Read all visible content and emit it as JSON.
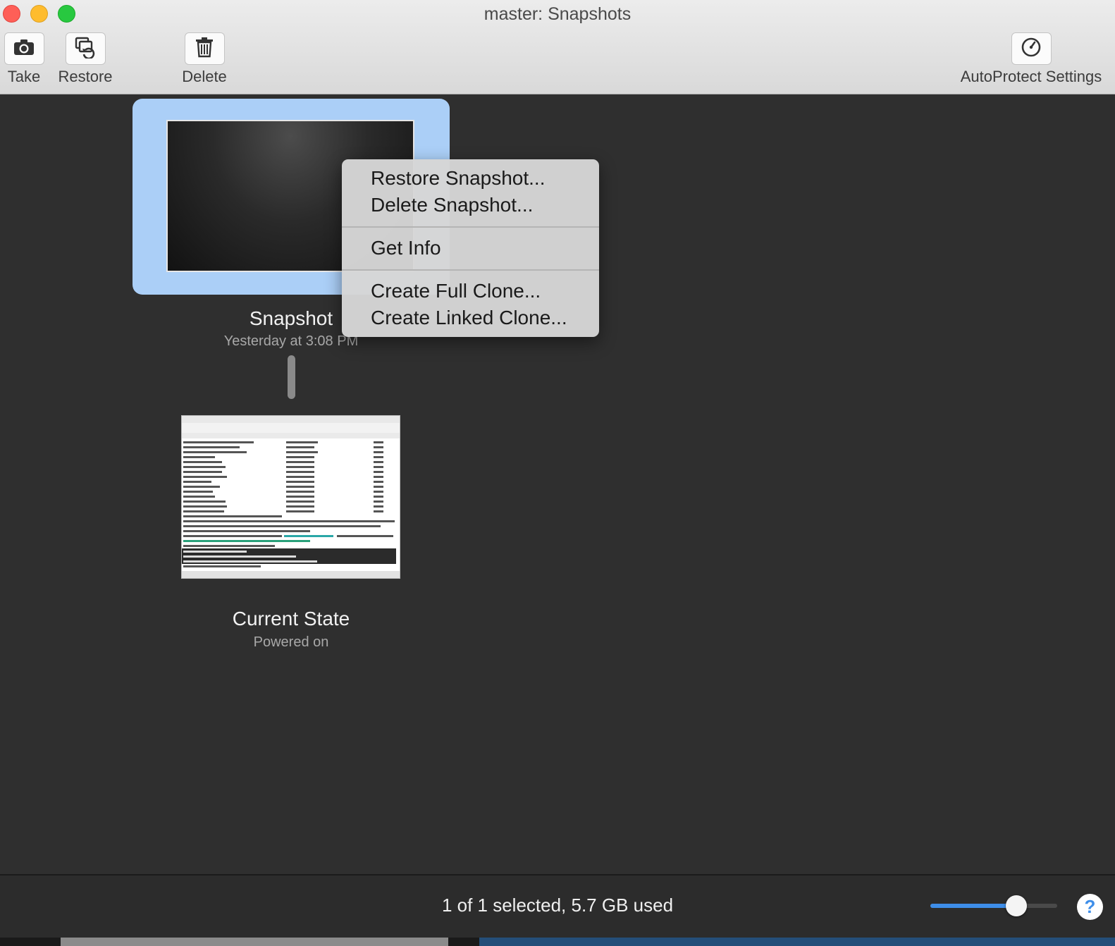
{
  "window": {
    "title": "master: Snapshots"
  },
  "toolbar": {
    "take_label": "Take",
    "restore_label": "Restore",
    "delete_label": "Delete",
    "autoprotect_label": "AutoProtect Settings"
  },
  "snapshot": {
    "name": "Snapshot",
    "date": "Yesterday at 3:08 PM"
  },
  "current": {
    "name": "Current State",
    "state": "Powered on"
  },
  "context_menu": {
    "items": [
      "Restore Snapshot...",
      "Delete Snapshot...",
      "Get Info",
      "Create Full Clone...",
      "Create Linked Clone..."
    ]
  },
  "footer": {
    "status": "1 of 1 selected, 5.7 GB used",
    "zoom_fraction": 0.68,
    "help": "?"
  },
  "colors": {
    "selection": "#abcff7",
    "accent": "#3e8ee9",
    "background": "#2f2f2f"
  }
}
